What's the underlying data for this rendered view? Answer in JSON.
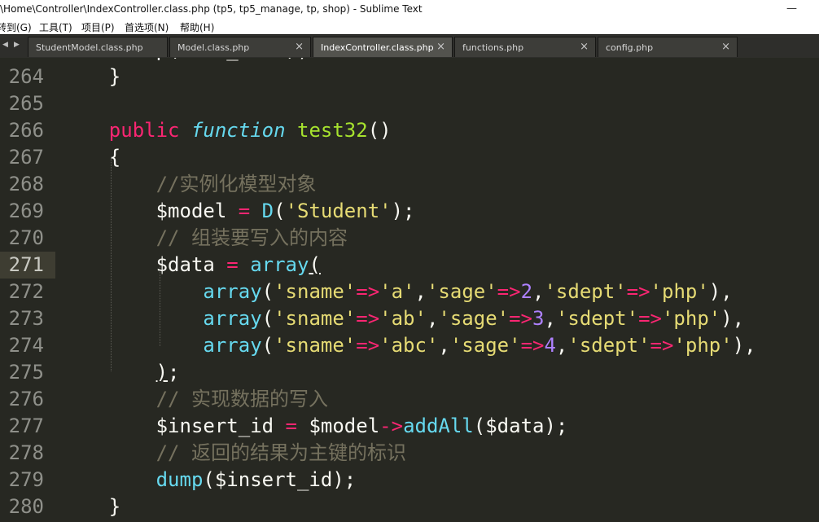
{
  "window": {
    "title": "\\Home\\Controller\\IndexController.class.php (tp5, tp5_manage, tp, shop) - Sublime Text",
    "minimize_glyph": "—"
  },
  "menu": {
    "items": [
      "转到(G)",
      "工具(T)",
      "项目(P)",
      "首选项(N)",
      "帮助(H)"
    ]
  },
  "tabs": {
    "nav_left": "◀",
    "nav_right": "▶",
    "close_glyph": "×",
    "items": [
      {
        "label": "StudentModel.class.php",
        "active": false
      },
      {
        "label": "Model.class.php",
        "active": false
      },
      {
        "label": "IndexController.class.php",
        "active": true
      },
      {
        "label": "functions.php",
        "active": false
      },
      {
        "label": "config.php",
        "active": false
      }
    ]
  },
  "editor": {
    "current_line": 271,
    "colors": {
      "background": "#272822",
      "keyword": "#f92672",
      "storage_type": "#66d9ef",
      "function_name": "#a6e22e",
      "string": "#e6db74",
      "comment": "#75715e",
      "number": "#ae81ff",
      "text": "#f8f8f2"
    },
    "lines": [
      {
        "number": "264",
        "tokens": [
          {
            "t": "    }",
            "c": "text"
          }
        ]
      },
      {
        "number": "265",
        "tokens": []
      },
      {
        "number": "266",
        "tokens": [
          {
            "t": "    public",
            "c": "keyword"
          },
          {
            "t": " ",
            "c": "text"
          },
          {
            "t": "function",
            "c": "storage_type",
            "italic": true
          },
          {
            "t": " ",
            "c": "text"
          },
          {
            "t": "test32",
            "c": "function_name"
          },
          {
            "t": "()",
            "c": "text"
          }
        ]
      },
      {
        "number": "267",
        "tokens": [
          {
            "t": "    {",
            "c": "text"
          }
        ]
      },
      {
        "number": "268",
        "tokens": [
          {
            "t": "        //实例化模型对象",
            "c": "comment"
          }
        ]
      },
      {
        "number": "269",
        "tokens": [
          {
            "t": "        $model ",
            "c": "text"
          },
          {
            "t": "=",
            "c": "keyword"
          },
          {
            "t": " ",
            "c": "text"
          },
          {
            "t": "D",
            "c": "storage_type"
          },
          {
            "t": "(",
            "c": "text"
          },
          {
            "t": "'Student'",
            "c": "string"
          },
          {
            "t": ");",
            "c": "text"
          }
        ]
      },
      {
        "number": "270",
        "tokens": [
          {
            "t": "        // 组装要写入的内容",
            "c": "comment"
          }
        ]
      },
      {
        "number": "271",
        "tokens": [
          {
            "t": "        $data ",
            "c": "text"
          },
          {
            "t": "=",
            "c": "keyword"
          },
          {
            "t": " ",
            "c": "text"
          },
          {
            "t": "array",
            "c": "storage_type"
          },
          {
            "t": "(",
            "c": "text",
            "underline": true
          }
        ]
      },
      {
        "number": "272",
        "tokens": [
          {
            "t": "            ",
            "c": "text"
          },
          {
            "t": "array",
            "c": "storage_type"
          },
          {
            "t": "(",
            "c": "text"
          },
          {
            "t": "'sname'",
            "c": "string"
          },
          {
            "t": "=>",
            "c": "keyword"
          },
          {
            "t": "'a'",
            "c": "string"
          },
          {
            "t": ",",
            "c": "text"
          },
          {
            "t": "'sage'",
            "c": "string"
          },
          {
            "t": "=>",
            "c": "keyword"
          },
          {
            "t": "2",
            "c": "number"
          },
          {
            "t": ",",
            "c": "text"
          },
          {
            "t": "'sdept'",
            "c": "string"
          },
          {
            "t": "=>",
            "c": "keyword"
          },
          {
            "t": "'php'",
            "c": "string"
          },
          {
            "t": "),",
            "c": "text"
          }
        ]
      },
      {
        "number": "273",
        "tokens": [
          {
            "t": "            ",
            "c": "text"
          },
          {
            "t": "array",
            "c": "storage_type"
          },
          {
            "t": "(",
            "c": "text"
          },
          {
            "t": "'sname'",
            "c": "string"
          },
          {
            "t": "=>",
            "c": "keyword"
          },
          {
            "t": "'ab'",
            "c": "string"
          },
          {
            "t": ",",
            "c": "text"
          },
          {
            "t": "'sage'",
            "c": "string"
          },
          {
            "t": "=>",
            "c": "keyword"
          },
          {
            "t": "3",
            "c": "number"
          },
          {
            "t": ",",
            "c": "text"
          },
          {
            "t": "'sdept'",
            "c": "string"
          },
          {
            "t": "=>",
            "c": "keyword"
          },
          {
            "t": "'php'",
            "c": "string"
          },
          {
            "t": "),",
            "c": "text"
          }
        ]
      },
      {
        "number": "274",
        "tokens": [
          {
            "t": "            ",
            "c": "text"
          },
          {
            "t": "array",
            "c": "storage_type"
          },
          {
            "t": "(",
            "c": "text"
          },
          {
            "t": "'sname'",
            "c": "string"
          },
          {
            "t": "=>",
            "c": "keyword"
          },
          {
            "t": "'abc'",
            "c": "string"
          },
          {
            "t": ",",
            "c": "text"
          },
          {
            "t": "'sage'",
            "c": "string"
          },
          {
            "t": "=>",
            "c": "keyword"
          },
          {
            "t": "4",
            "c": "number"
          },
          {
            "t": ",",
            "c": "text"
          },
          {
            "t": "'sdept'",
            "c": "string"
          },
          {
            "t": "=>",
            "c": "keyword"
          },
          {
            "t": "'php'",
            "c": "string"
          },
          {
            "t": "),",
            "c": "text"
          }
        ]
      },
      {
        "number": "275",
        "tokens": [
          {
            "t": "        ",
            "c": "text"
          },
          {
            "t": ")",
            "c": "text",
            "underline": true
          },
          {
            "t": ";",
            "c": "text"
          }
        ]
      },
      {
        "number": "276",
        "tokens": [
          {
            "t": "        // 实现数据的写入",
            "c": "comment"
          }
        ]
      },
      {
        "number": "277",
        "tokens": [
          {
            "t": "        $insert_id ",
            "c": "text"
          },
          {
            "t": "=",
            "c": "keyword"
          },
          {
            "t": " $model",
            "c": "text"
          },
          {
            "t": "->",
            "c": "keyword"
          },
          {
            "t": "addAll",
            "c": "storage_type"
          },
          {
            "t": "($data);",
            "c": "text"
          }
        ]
      },
      {
        "number": "278",
        "tokens": [
          {
            "t": "        // 返回的结果为主键的标识",
            "c": "comment"
          }
        ]
      },
      {
        "number": "279",
        "tokens": [
          {
            "t": "        ",
            "c": "text"
          },
          {
            "t": "dump",
            "c": "storage_type"
          },
          {
            "t": "($insert_id);",
            "c": "text"
          }
        ]
      },
      {
        "number": "280",
        "tokens": [
          {
            "t": "    }",
            "c": "text"
          }
        ]
      }
    ]
  }
}
